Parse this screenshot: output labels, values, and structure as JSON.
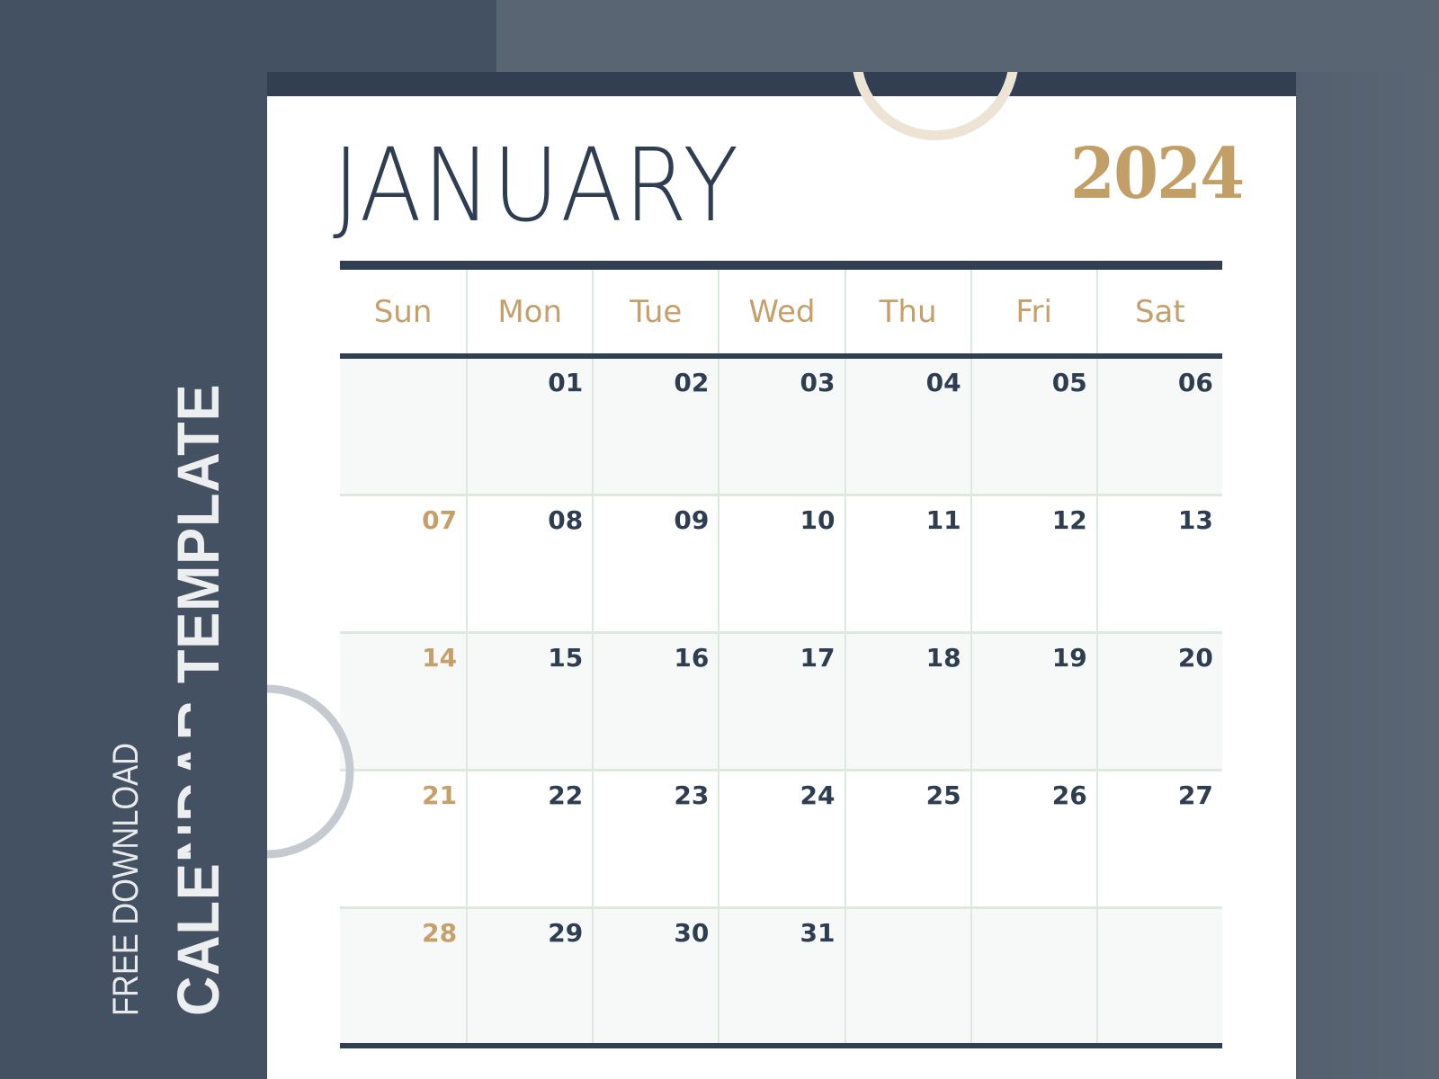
{
  "sidebar": {
    "subtitle": "FREE DOWNLOAD",
    "title": "CALENDAR TEMPLATE"
  },
  "calendar": {
    "month": "JANUARY",
    "year": "2024",
    "weekdays": [
      "Sun",
      "Mon",
      "Tue",
      "Wed",
      "Thu",
      "Fri",
      "Sat"
    ],
    "weeks": [
      [
        "",
        "01",
        "02",
        "03",
        "04",
        "05",
        "06"
      ],
      [
        "07",
        "08",
        "09",
        "10",
        "11",
        "12",
        "13"
      ],
      [
        "14",
        "15",
        "16",
        "17",
        "18",
        "19",
        "20"
      ],
      [
        "21",
        "22",
        "23",
        "24",
        "25",
        "26",
        "27"
      ],
      [
        "28",
        "29",
        "30",
        "31",
        "",
        "",
        ""
      ]
    ]
  },
  "colors": {
    "navy": "#323f52",
    "gold": "#c5a06b",
    "background": "#445163",
    "cell_shade": "#f7f8f8",
    "grid_line": "#dfe8df"
  }
}
